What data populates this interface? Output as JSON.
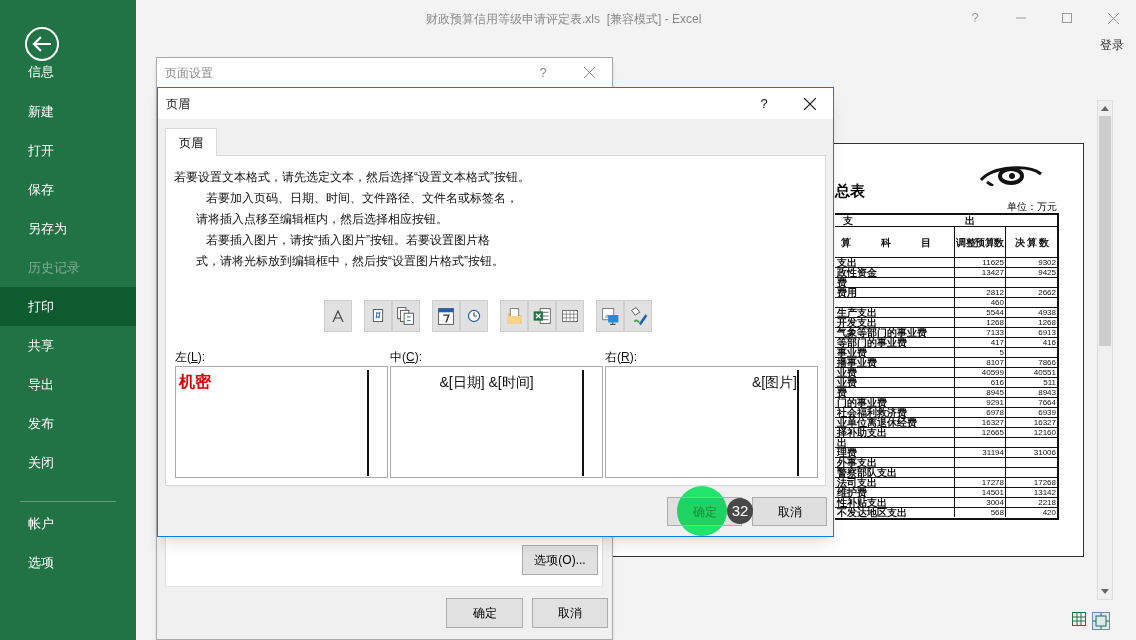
{
  "window": {
    "title": "财政预算信用等级申请评定表.xls  [兼容模式] - Excel",
    "help": "?",
    "sign_in": "登录"
  },
  "backstage": {
    "items": [
      {
        "label": "信息",
        "selected": false,
        "disabled": false
      },
      {
        "label": "新建",
        "selected": false,
        "disabled": false
      },
      {
        "label": "打开",
        "selected": false,
        "disabled": false
      },
      {
        "label": "保存",
        "selected": false,
        "disabled": false
      },
      {
        "label": "另存为",
        "selected": false,
        "disabled": false
      },
      {
        "label": "历史记录",
        "selected": false,
        "disabled": true
      },
      {
        "label": "打印",
        "selected": true,
        "disabled": false
      },
      {
        "label": "共享",
        "selected": false,
        "disabled": false
      },
      {
        "label": "导出",
        "selected": false,
        "disabled": false
      },
      {
        "label": "发布",
        "selected": false,
        "disabled": false
      },
      {
        "label": "关闭",
        "selected": false,
        "disabled": false
      }
    ],
    "bottom_items": [
      {
        "label": "帐户",
        "selected": false,
        "disabled": false
      },
      {
        "label": "选项",
        "selected": false,
        "disabled": false
      }
    ]
  },
  "preview": {
    "title": "总表",
    "unit": "单位：万元",
    "group_header": [
      "支",
      "出"
    ],
    "subject_header": [
      "算",
      "科",
      "目"
    ],
    "columns": [
      "调整预算数",
      "决 算 数"
    ],
    "rows": [
      {
        "item": "支出",
        "budget": "11625",
        "final": "9302"
      },
      {
        "item": "政性资金",
        "budget": "13427",
        "final": "9425"
      },
      {
        "item": "费"
      },
      {
        "item": "费用",
        "budget": "2812",
        "final": "2662"
      },
      {
        "budget": "460"
      },
      {
        "item": "生产支出",
        "budget": "5544",
        "final": "4938"
      },
      {
        "item": "开发支出",
        "budget": "1268",
        "final": "1268"
      },
      {
        "item": "气象等部门的事业费",
        "budget": "7133",
        "final": "6913"
      },
      {
        "item": "等部门的事业费",
        "budget": "417",
        "final": "416"
      },
      {
        "item": "事业费",
        "budget": "5"
      },
      {
        "item": "播事业费",
        "budget": "8107",
        "final": "7866"
      },
      {
        "item": "业费",
        "budget": "40599",
        "final": "40551"
      },
      {
        "item": "业费",
        "budget": "616",
        "final": "511"
      },
      {
        "item": "费",
        "budget": "8945",
        "final": "8943"
      },
      {
        "item": "门的事业费",
        "budget": "9291",
        "final": "7664"
      },
      {
        "item": "社会福利救济费",
        "budget": "6978",
        "final": "6939"
      },
      {
        "item": "业单位离退休经费",
        "budget": "16327",
        "final": "16327"
      },
      {
        "item": "择补助支出",
        "budget": "12665",
        "final": "12160"
      },
      {
        "item": "出"
      },
      {
        "item": "理费",
        "budget": "31194",
        "final": "31006"
      },
      {
        "item": "外事支出"
      },
      {
        "item": "警察部队支出"
      },
      {
        "item": "法司支出",
        "budget": "17278",
        "final": "17268"
      },
      {
        "item": "维护费",
        "budget": "14501",
        "final": "13142"
      },
      {
        "item": "性补贴支出",
        "budget": "3004",
        "final": "2218"
      },
      {
        "item": "不发达地区支出",
        "budget": "568",
        "final": "420"
      }
    ]
  },
  "page_setup_dialog": {
    "title": "页面设置",
    "help": "?",
    "options_button": "选项(O)...",
    "ok_button": "确定",
    "cancel_button": "取消"
  },
  "header_dialog": {
    "title": "页眉",
    "help": "?",
    "tabs": [
      {
        "label": "页眉",
        "selected": true
      }
    ],
    "instructions": [
      "若要设置文本格式，请先选定文本，然后选择“设置文本格式”按钮。",
      "若要加入页码、日期、时间、文件路径、文件名或标签名，",
      "请将插入点移至编辑框内，然后选择相应按钮。",
      "若要插入图片，请按“插入图片”按钮。若要设置图片格",
      "式，请将光标放到编辑框中，然后按“设置图片格式”按钮。"
    ],
    "sections": [
      {
        "label_prefix": "左(",
        "access_key": "L",
        "label_suffix": "):",
        "content": "机密",
        "kind": "formatted"
      },
      {
        "label_prefix": "中(",
        "access_key": "C",
        "label_suffix": "):",
        "content": "&[日期] &[时间]",
        "kind": "code"
      },
      {
        "label_prefix": "右(",
        "access_key": "R",
        "label_suffix": "):",
        "content": "&[图片]",
        "kind": "code"
      }
    ],
    "ok_button": {
      "label": "确定",
      "highlighted": true
    },
    "cancel_button": "取消",
    "step_badge": "32"
  }
}
